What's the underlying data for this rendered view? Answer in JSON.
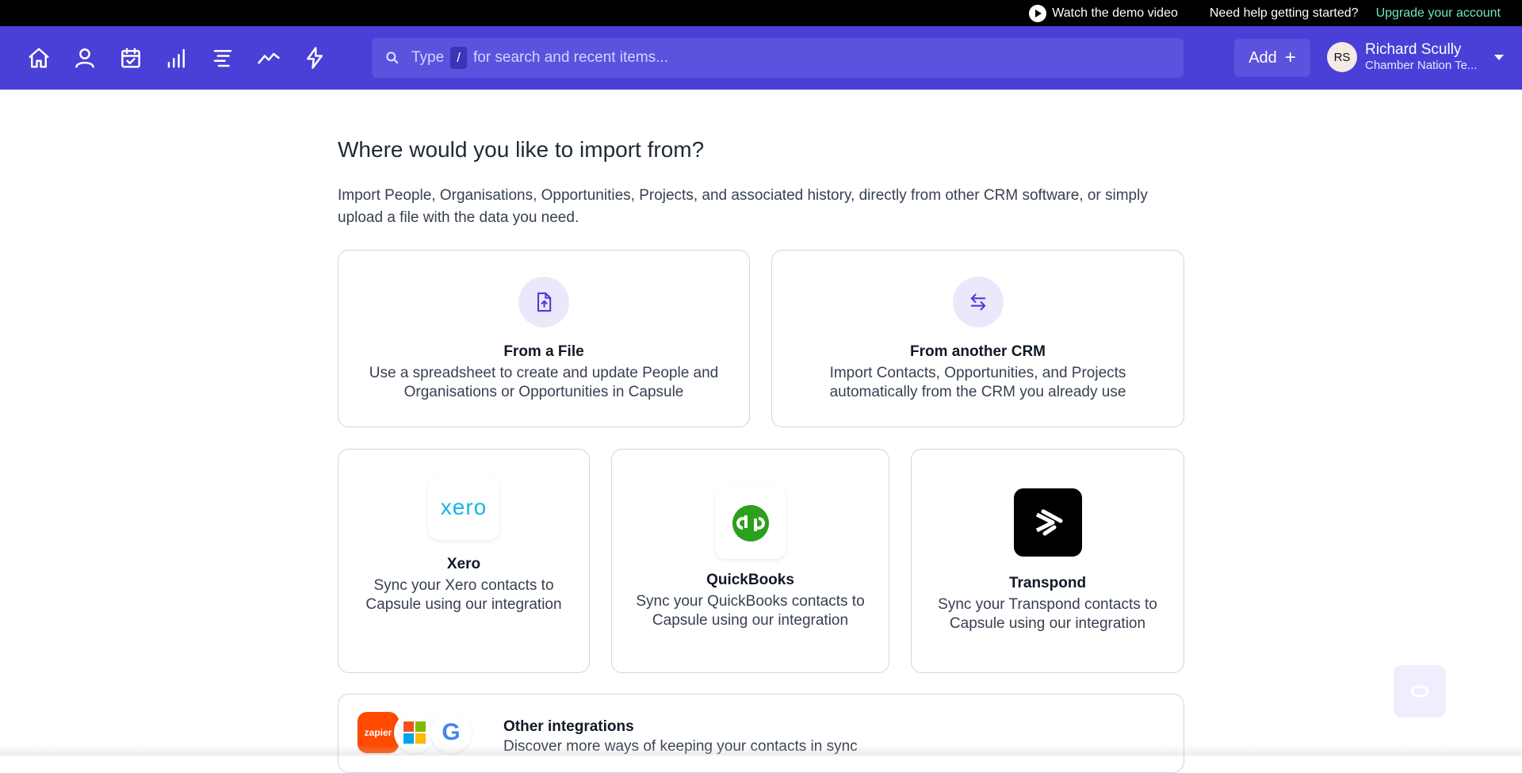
{
  "topbar": {
    "demo_label": "Watch the demo video",
    "help_label": "Need help getting started?",
    "upgrade_label": "Upgrade your account",
    "upgrade_color": "#6ee7b7"
  },
  "nav": {
    "background": "#4a3fd6",
    "icons": [
      "home-icon",
      "person-icon",
      "calendar-check-icon",
      "bar-chart-icon",
      "list-icon",
      "trend-line-icon",
      "lightning-icon"
    ],
    "search": {
      "type_label": "Type",
      "slash": "/",
      "placeholder": "for search and recent items..."
    },
    "add_label": "Add",
    "add_plus": "+",
    "user": {
      "initials": "RS",
      "name": "Richard Scully",
      "org": "Chamber Nation Te..."
    }
  },
  "main": {
    "heading": "Where would you like to import from?",
    "intro": "Import People, Organisations, Opportunities, Projects, and associated history, directly from other CRM software, or simply upload a file with the data you need.",
    "cards": [
      {
        "title": "From a File",
        "desc": "Use a spreadsheet to create and update People and Organisations or Opportunities in Capsule",
        "icon": "file-upload-icon"
      },
      {
        "title": "From another CRM",
        "desc": "Import Contacts, Opportunities, and Projects automatically from the CRM you already use",
        "icon": "swap-arrows-icon"
      }
    ],
    "integrations": [
      {
        "title": "Xero",
        "desc": "Sync your Xero contacts to Capsule using our integration",
        "logo_text": "xero",
        "logo_color": "#13b5ea"
      },
      {
        "title": "QuickBooks",
        "desc": "Sync your QuickBooks contacts to Capsule using our integration",
        "logo_color": "#2ca01c"
      },
      {
        "title": "Transpond",
        "desc": "Sync your Transpond contacts to Capsule using our integration",
        "logo_color": "#000000"
      }
    ],
    "other": {
      "title": "Other integrations",
      "desc": "Discover more ways of keeping your contacts in sync",
      "zapier_text": "zapier",
      "google_letter": "G"
    }
  }
}
